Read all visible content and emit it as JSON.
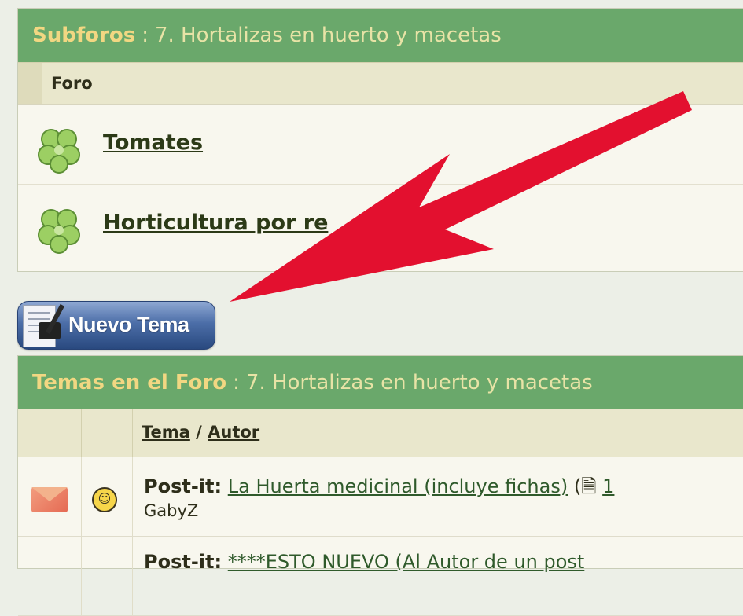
{
  "subforums": {
    "title_strong": "Subforos",
    "separator": ":",
    "title_rest": "7. Hortalizas en huerto y macetas",
    "column_header": "Foro",
    "items": [
      {
        "name": "Tomates",
        "icon": "clover-icon"
      },
      {
        "name": "Horticultura por re",
        "icon": "clover-icon"
      }
    ]
  },
  "new_topic_button": {
    "label": "Nuevo Tema"
  },
  "topics": {
    "title_strong": "Temas en el Foro",
    "separator": ":",
    "title_rest": "7. Hortalizas en huerto y macetas",
    "column_header": {
      "topic": "Tema",
      "slash": "/",
      "author": "Autor"
    },
    "rows": [
      {
        "prefix": "Post-it:",
        "title": "La Huerta medicinal (incluye fichas)",
        "meta": " (",
        "pages": "1",
        "author": "GabyZ",
        "status_icon": "envelope-icon",
        "mood_icon": "grin-icon"
      },
      {
        "prefix": "Post-it:",
        "title": "****ESTO NUEVO (Al Autor de un post",
        "meta": "",
        "pages": "",
        "author": "",
        "status_icon": "envelope-icon",
        "mood_icon": ""
      }
    ]
  },
  "colors": {
    "header_bg": "#6aa86b",
    "header_title": "#f2d782",
    "arrow": "#e3102f",
    "button_blue": "#4c6ea8"
  }
}
